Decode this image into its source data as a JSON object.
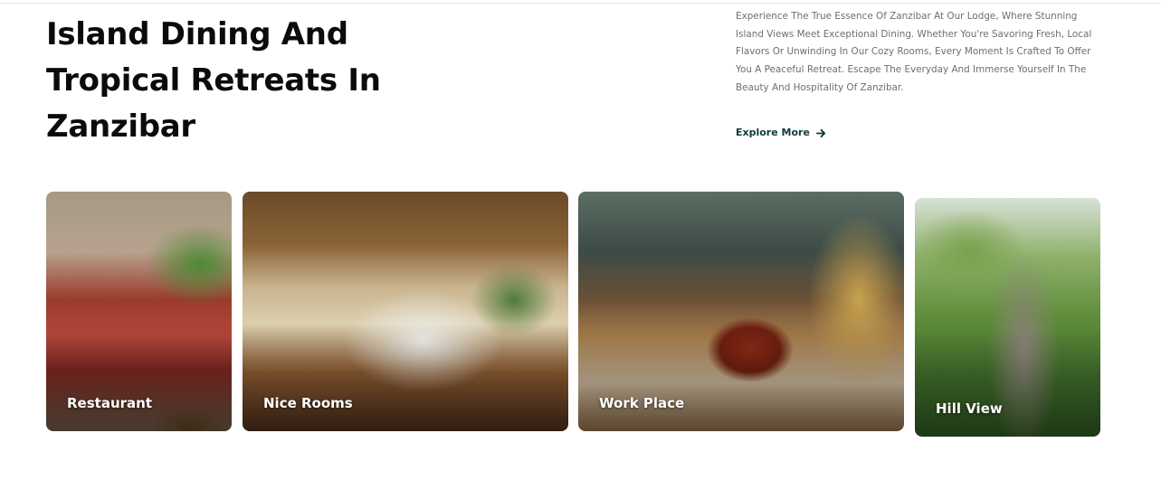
{
  "hero": {
    "title": "Island Dining And Tropical Retreats In Zanzibar",
    "description": "Experience The True Essence Of Zanzibar At Our Lodge, Where Stunning Island Views Meet Exceptional Dining. Whether You're Savoring Fresh, Local Flavors Or Unwinding In Our Cozy Rooms, Every Moment Is Crafted To Offer You A Peaceful Retreat. Escape The Everyday And Immerse Yourself In The Beauty And Hospitality Of Zanzibar.",
    "cta_label": "Explore More",
    "cta_icon": "arrow-right-icon"
  },
  "cards": [
    {
      "label": "Restaurant"
    },
    {
      "label": "Nice Rooms"
    },
    {
      "label": "Work Place"
    },
    {
      "label": "Hill View"
    }
  ],
  "colors": {
    "heading": "#0b0b0b",
    "body_text": "#6e6e6e",
    "cta": "#0f3b3a",
    "card_label": "#ffffff"
  }
}
